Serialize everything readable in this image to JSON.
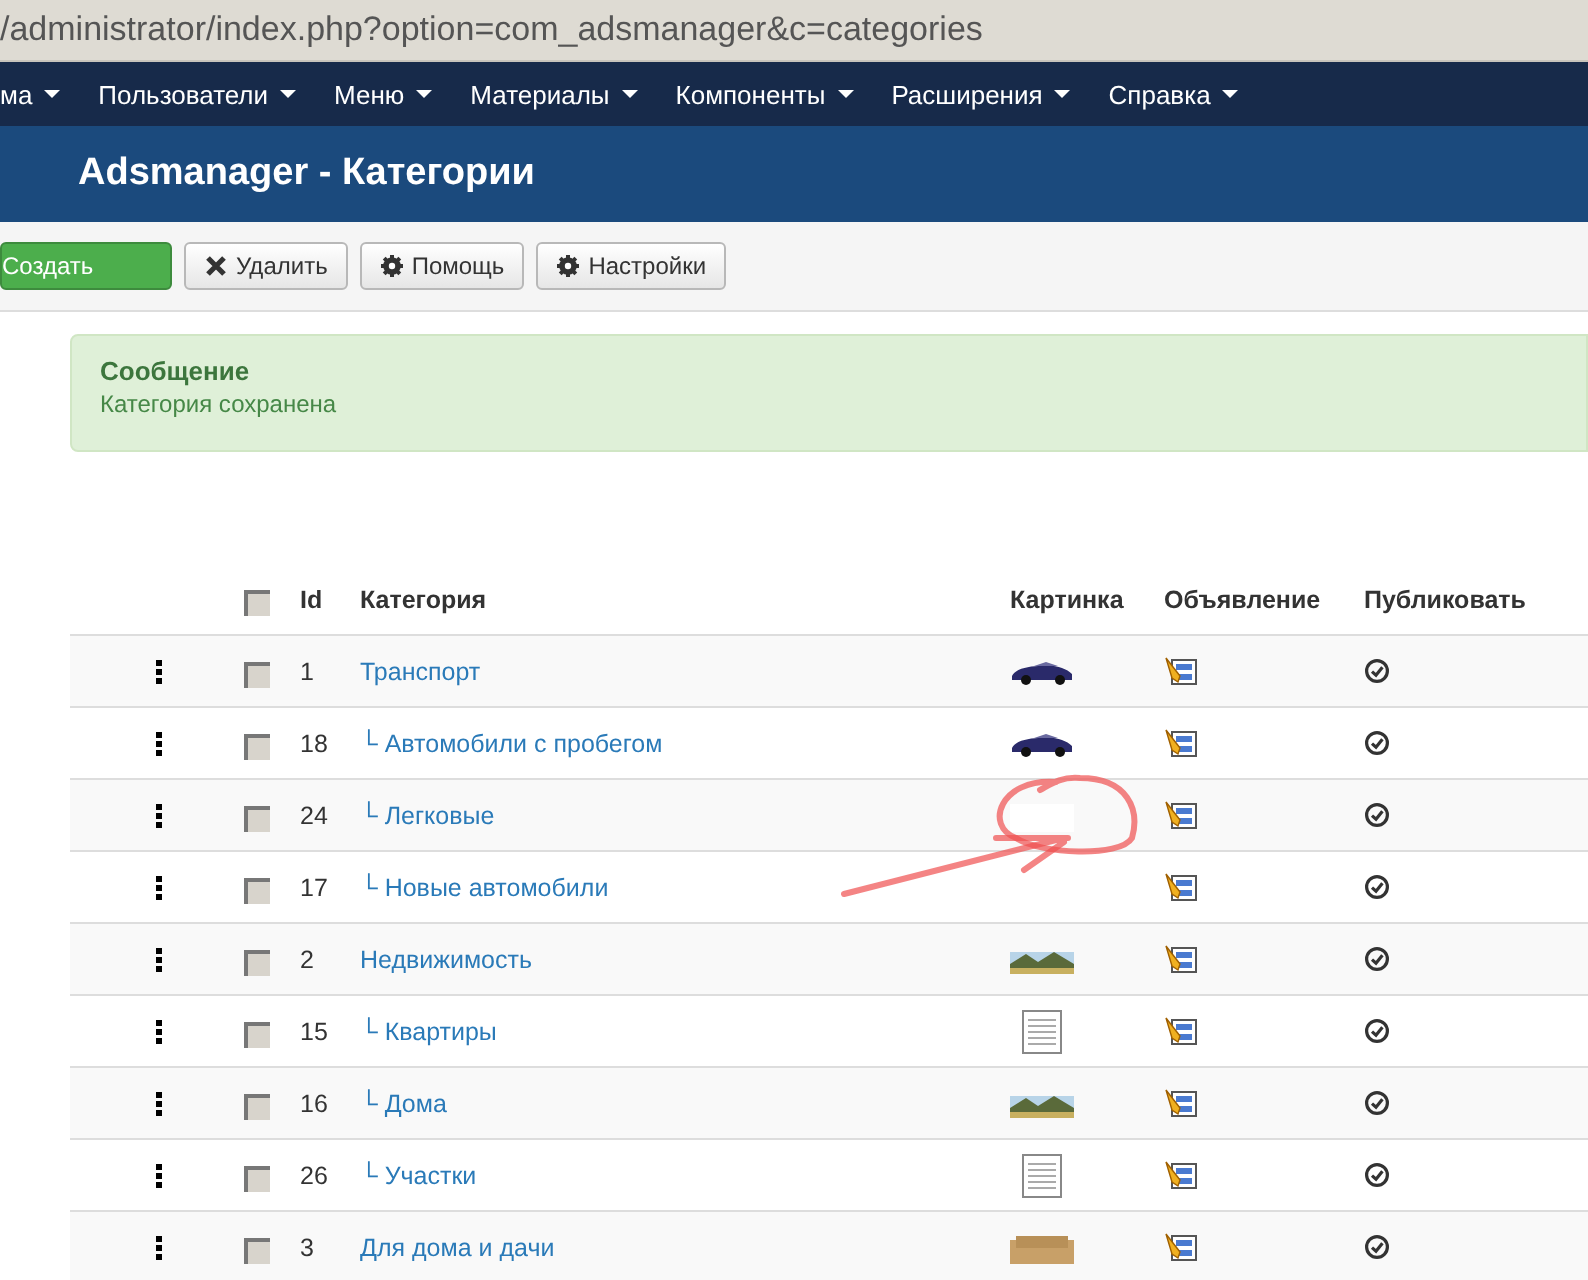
{
  "address_bar": {
    "url": "/administrator/index.php?option=com_adsmanager&c=categories"
  },
  "menu": [
    {
      "label": "ма"
    },
    {
      "label": "Пользователи"
    },
    {
      "label": "Меню"
    },
    {
      "label": "Материалы"
    },
    {
      "label": "Компоненты"
    },
    {
      "label": "Расширения"
    },
    {
      "label": "Справка"
    }
  ],
  "page_title": "Adsmanager - Категории",
  "toolbar": [
    {
      "label": "Создать",
      "kind": "primary"
    },
    {
      "label": "Удалить",
      "kind": "delete"
    },
    {
      "label": "Помощь",
      "kind": "gear"
    },
    {
      "label": "Настройки",
      "kind": "gear"
    }
  ],
  "message": {
    "heading": "Сообщение",
    "text": "Категория сохранена"
  },
  "table": {
    "columns": [
      {
        "label": "Id"
      },
      {
        "label": "Категория"
      },
      {
        "label": "Картинка"
      },
      {
        "label": "Объявление"
      },
      {
        "label": "Публиковать"
      }
    ],
    "header_checked": false,
    "rows": [
      {
        "id": "1",
        "name": "Транспорт",
        "picture": {
          "kind": "car"
        },
        "checked": false,
        "published": true,
        "children": [
          {
            "id": "18",
            "name": "└ Автомобили с пробегом",
            "picture": {
              "kind": "car"
            },
            "checked": false,
            "published": true
          },
          {
            "id": "24",
            "name": "└ Легковые",
            "picture": {
              "kind": "blank"
            },
            "checked": false,
            "published": true
          },
          {
            "id": "17",
            "name": "└ Новые автомобили",
            "checked": false,
            "published": true
          }
        ]
      },
      {
        "id": "2",
        "name": "Недвижимость",
        "picture": {
          "kind": "landscape"
        },
        "checked": false,
        "published": true,
        "children": [
          {
            "id": "15",
            "name": "└ Квартиры",
            "picture": {
              "kind": "document"
            },
            "checked": false,
            "published": true
          },
          {
            "id": "16",
            "name": "└ Дома",
            "picture": {
              "kind": "landscape"
            },
            "checked": false,
            "published": true
          },
          {
            "id": "26",
            "name": "└ Участки",
            "picture": {
              "kind": "document"
            },
            "checked": false,
            "published": true
          }
        ]
      },
      {
        "id": "3",
        "name": "Для дома и дачи",
        "picture": {
          "kind": "sofa"
        },
        "checked": false,
        "published": true
      }
    ]
  }
}
